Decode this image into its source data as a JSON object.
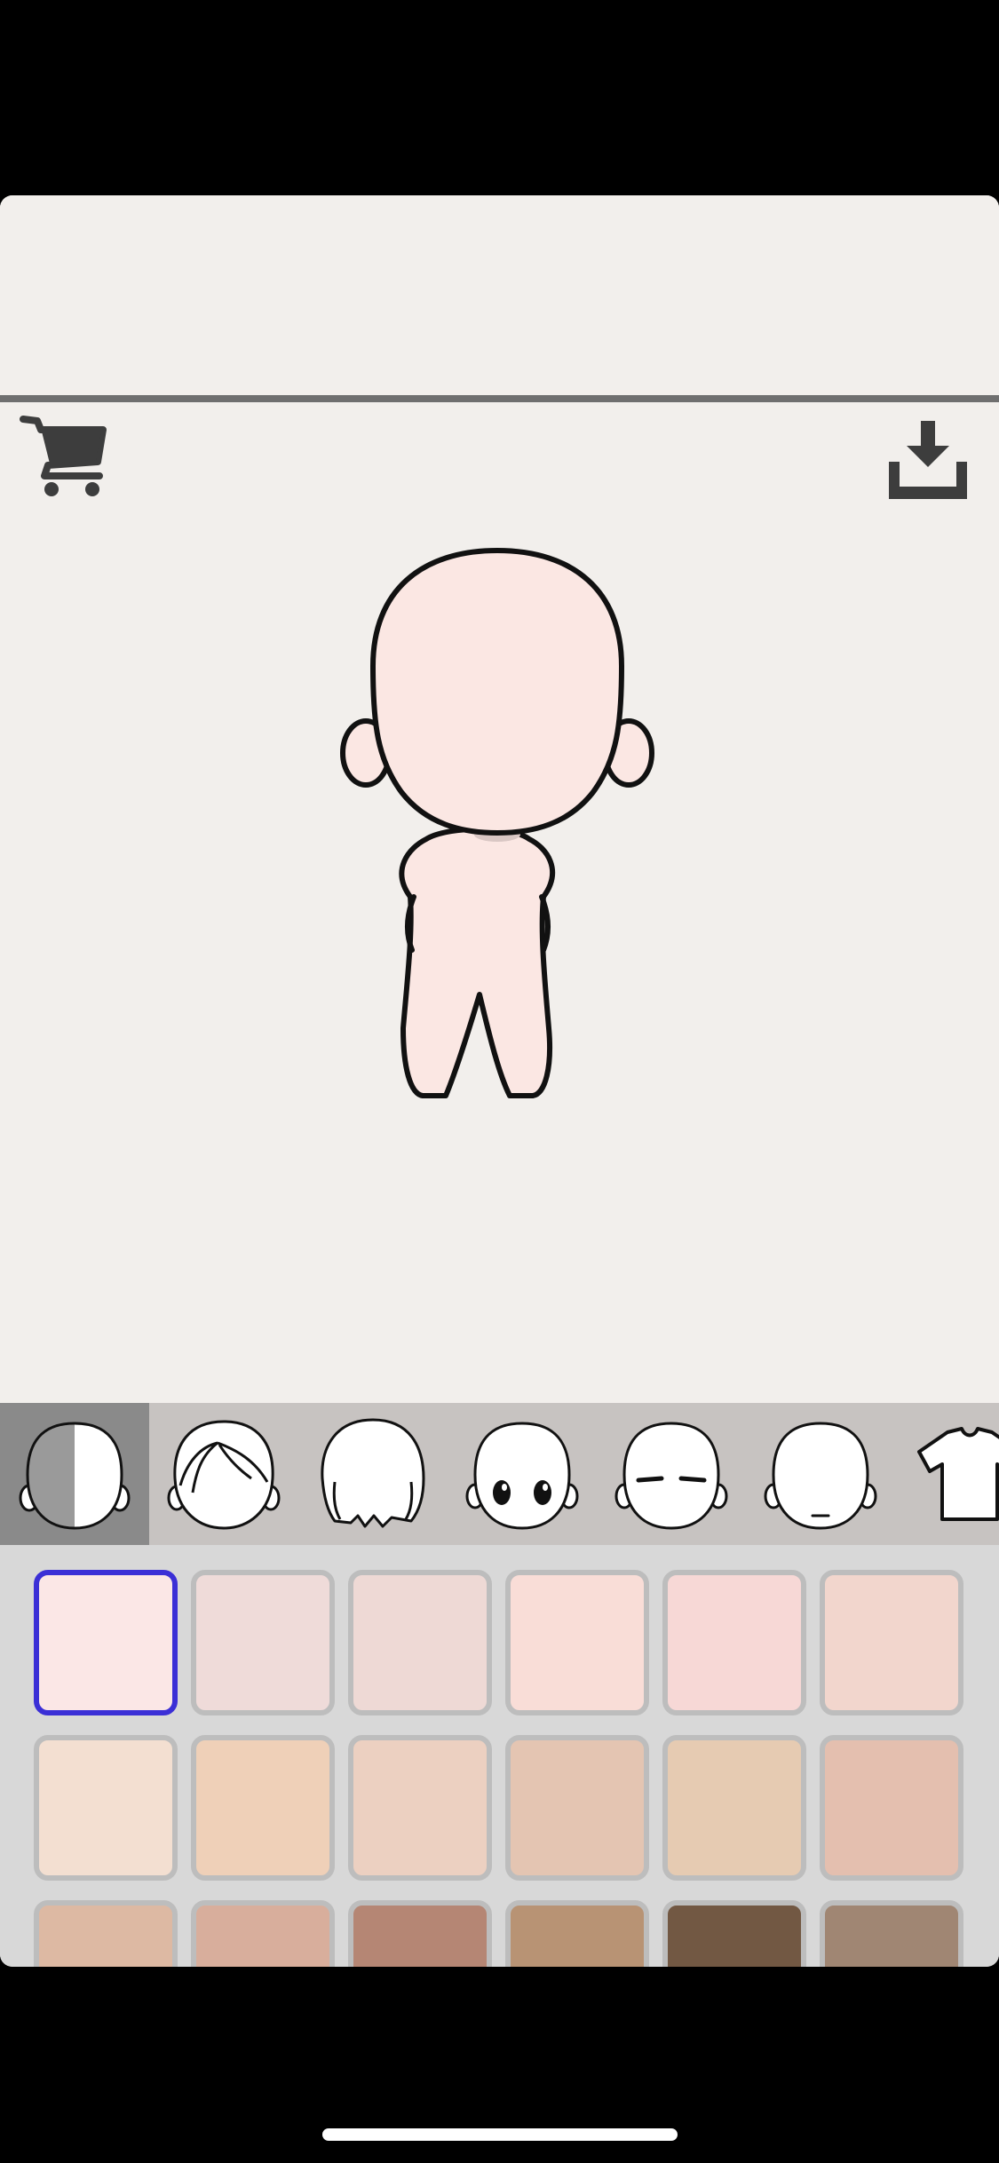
{
  "icons": {
    "cart": "cart-icon",
    "download": "download-icon"
  },
  "colors": {
    "app_background": "#f2efec",
    "tab_bar": "#c7c3c1",
    "tab_active": "#8a8a8a",
    "palette_background": "#d8d8d8",
    "selected_outline": "#3b2fd6",
    "skin": "#fbe7e3"
  },
  "tabs": [
    {
      "id": "skin",
      "icon": "skin-tone-tab-icon",
      "active": true
    },
    {
      "id": "front-hair",
      "icon": "front-hair-tab-icon",
      "active": false
    },
    {
      "id": "back-hair",
      "icon": "back-hair-tab-icon",
      "active": false
    },
    {
      "id": "eyes",
      "icon": "eyes-tab-icon",
      "active": false
    },
    {
      "id": "eyebrows",
      "icon": "eyebrows-tab-icon",
      "active": false
    },
    {
      "id": "mouth",
      "icon": "mouth-tab-icon",
      "active": false
    },
    {
      "id": "clothes",
      "icon": "shirt-tab-icon",
      "active": false
    }
  ],
  "swatches": [
    {
      "color": "#fbe7e6",
      "selected": true
    },
    {
      "color": "#efdbd9",
      "selected": false
    },
    {
      "color": "#eed9d5",
      "selected": false
    },
    {
      "color": "#f9ddd7",
      "selected": false
    },
    {
      "color": "#f7d8d6",
      "selected": false
    },
    {
      "color": "#f2d6cd",
      "selected": false
    },
    {
      "color": "#f3dfd1",
      "selected": false
    },
    {
      "color": "#efd0b8",
      "selected": false
    },
    {
      "color": "#ecd0c1",
      "selected": false
    },
    {
      "color": "#e4c5b2",
      "selected": false
    },
    {
      "color": "#e6cbb2",
      "selected": false
    },
    {
      "color": "#e4bfaf",
      "selected": false
    },
    {
      "color": "#ddb9a3",
      "selected": false
    },
    {
      "color": "#d8ae9c",
      "selected": false
    },
    {
      "color": "#b58674",
      "selected": false
    },
    {
      "color": "#b89374",
      "selected": false
    },
    {
      "color": "#725843",
      "selected": false
    },
    {
      "color": "#a08673",
      "selected": false
    }
  ]
}
